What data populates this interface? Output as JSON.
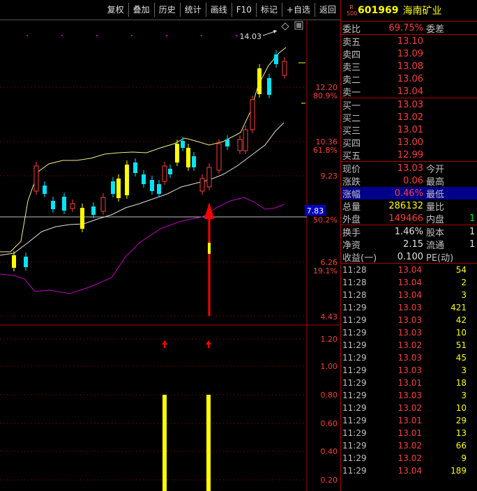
{
  "toolbar": {
    "items": [
      "复权",
      "叠加",
      "历史",
      "统计",
      "画线",
      "F10",
      "标记",
      "+自选",
      "返回"
    ]
  },
  "stock": {
    "code": "601969",
    "name": "海南矿业",
    "badge_top": "R",
    "badge_bottom": "500"
  },
  "chart": {
    "price_labels": [
      "14.03",
      "12.20",
      "80.9%",
      "10.36",
      "61.8%",
      "9.23",
      "7.83",
      "50.2%",
      "6.26",
      "19.1%",
      "4.43"
    ],
    "indicator_labels": [
      "1.20",
      "1.00",
      "0.80",
      "0.60",
      "0.40",
      "0.20"
    ],
    "high_marker": "14.03",
    "colors": {
      "up": "#ff3c3c",
      "down": "#00e5ff",
      "highlight": "#ffff00",
      "upper_band": "#f0f080",
      "lower_band": "#e0e0e0",
      "purple": "#c000c0"
    }
  },
  "quote": {
    "weibi_label": "委比",
    "weibi_value": "69.75%",
    "weicha_label": "委差",
    "sells": [
      {
        "label": "卖五",
        "price": "13.10"
      },
      {
        "label": "卖四",
        "price": "13.09"
      },
      {
        "label": "卖三",
        "price": "13.08"
      },
      {
        "label": "卖二",
        "price": "13.06"
      },
      {
        "label": "卖一",
        "price": "13.04"
      }
    ],
    "buys": [
      {
        "label": "买一",
        "price": "13.03"
      },
      {
        "label": "买二",
        "price": "13.02"
      },
      {
        "label": "买三",
        "price": "13.01"
      },
      {
        "label": "买四",
        "price": "13.00"
      },
      {
        "label": "买五",
        "price": "12.99"
      }
    ],
    "stats": [
      {
        "label": "现价",
        "value": "13.03",
        "label2": "今开",
        "value2": ""
      },
      {
        "label": "涨跌",
        "value": "0.06",
        "label2": "最高",
        "value2": ""
      },
      {
        "label": "涨幅",
        "value": "0.46%",
        "label2": "最低",
        "value2": ""
      },
      {
        "label": "总量",
        "value": "286132",
        "label2": "量比",
        "value2": ""
      },
      {
        "label": "外盘",
        "value": "149466",
        "label2": "内盘",
        "value2": "1"
      }
    ],
    "fund": [
      {
        "label": "换手",
        "value": "1.46%",
        "label2": "股本",
        "value2": "1"
      },
      {
        "label": "净资",
        "value": "2.15",
        "label2": "流通",
        "value2": "1"
      },
      {
        "label": "收益(一)",
        "value": "0.100",
        "label2": "PE(动)",
        "value2": ""
      }
    ]
  },
  "ticks": [
    {
      "time": "11:28",
      "price": "13.04",
      "vol": "54"
    },
    {
      "time": "11:28",
      "price": "13.04",
      "vol": "2"
    },
    {
      "time": "11:28",
      "price": "13.04",
      "vol": "3"
    },
    {
      "time": "11:29",
      "price": "13.03",
      "vol": "421"
    },
    {
      "time": "11:29",
      "price": "13.03",
      "vol": "42"
    },
    {
      "time": "11:29",
      "price": "13.03",
      "vol": "10"
    },
    {
      "time": "11:29",
      "price": "13.02",
      "vol": "51"
    },
    {
      "time": "11:29",
      "price": "13.03",
      "vol": "45"
    },
    {
      "time": "11:29",
      "price": "13.03",
      "vol": "3"
    },
    {
      "time": "11:29",
      "price": "13.01",
      "vol": "18"
    },
    {
      "time": "11:29",
      "price": "13.03",
      "vol": "3"
    },
    {
      "time": "11:29",
      "price": "13.02",
      "vol": "10"
    },
    {
      "time": "11:29",
      "price": "13.01",
      "vol": "29"
    },
    {
      "time": "11:29",
      "price": "13.01",
      "vol": "13"
    },
    {
      "time": "11:29",
      "price": "13.02",
      "vol": "66"
    },
    {
      "time": "11:29",
      "price": "13.02",
      "vol": "9"
    },
    {
      "time": "11:29",
      "price": "13.04",
      "vol": "189"
    }
  ]
}
